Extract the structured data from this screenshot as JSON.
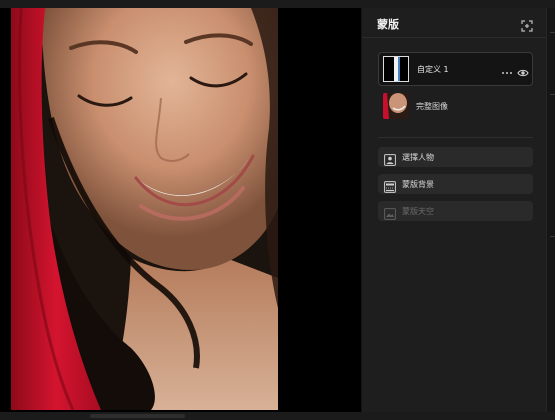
{
  "panel": {
    "title": "蒙版",
    "layer": {
      "name": "自定义 1"
    },
    "sub_layer": {
      "label": "完整图像"
    },
    "actions": [
      {
        "label": "選擇人物",
        "icon": "person-select-icon",
        "enabled": true
      },
      {
        "label": "蒙版背景",
        "icon": "background-mask-icon",
        "enabled": true
      },
      {
        "label": "蒙版天空",
        "icon": "sky-mask-icon",
        "enabled": false
      }
    ]
  },
  "colors": {
    "panel_bg": "#1e1e1e",
    "button_bg": "#2a2a2a",
    "accent_red": "#c8102e"
  }
}
